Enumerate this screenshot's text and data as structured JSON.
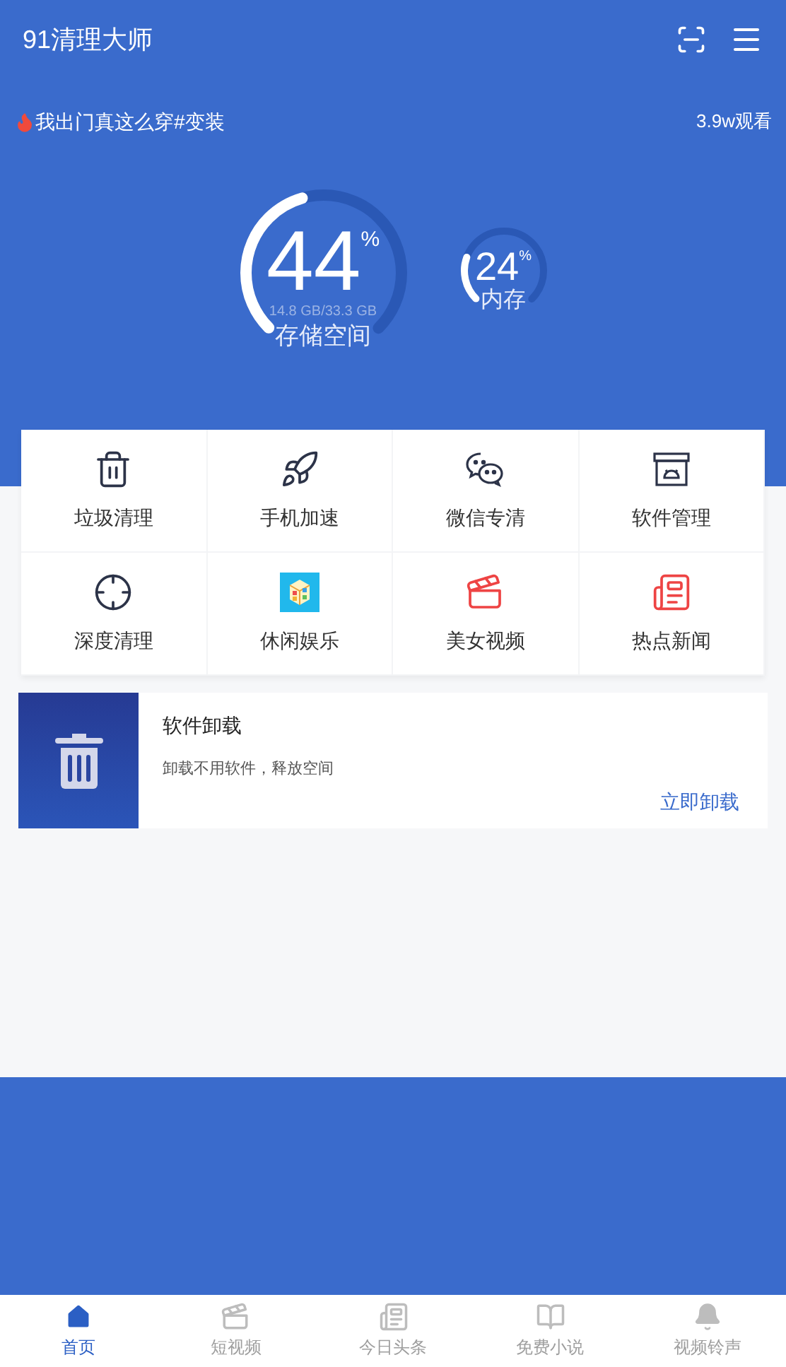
{
  "app_bar": {
    "title": "91清理大师"
  },
  "trending": {
    "headline": "我出门真这么穿#变装",
    "views": "3.9w观看"
  },
  "gauges": [
    {
      "kind": "large",
      "value": "44",
      "unit": "%",
      "detail": "14.8 GB/33.3 GB",
      "label": "存储空间",
      "level": 0.44
    },
    {
      "kind": "small",
      "value": "24",
      "unit": "%",
      "label": "内存",
      "level": 0.24
    }
  ],
  "features": [
    {
      "kind": "trash",
      "label": "垃圾清理"
    },
    {
      "kind": "rocket",
      "label": "手机加速"
    },
    {
      "kind": "chat",
      "label": "微信专清"
    },
    {
      "kind": "apps",
      "label": "软件管理"
    },
    {
      "kind": "target",
      "label": "深度清理"
    },
    {
      "kind": "game",
      "label": "休闲娱乐"
    },
    {
      "kind": "video",
      "label": "美女视频"
    },
    {
      "kind": "news",
      "label": "热点新闻"
    }
  ],
  "promo": {
    "title": "软件卸载",
    "description": "卸载不用软件，释放空间",
    "action": "立即卸载"
  },
  "bottom_nav": [
    {
      "kind": "home",
      "label": "首页",
      "selected": true
    },
    {
      "kind": "video",
      "label": "短视频",
      "selected": false
    },
    {
      "kind": "news",
      "label": "今日头条",
      "selected": false
    },
    {
      "kind": "book",
      "label": "免费小说",
      "selected": false
    },
    {
      "kind": "bell",
      "label": "视频铃声",
      "selected": false
    }
  ]
}
